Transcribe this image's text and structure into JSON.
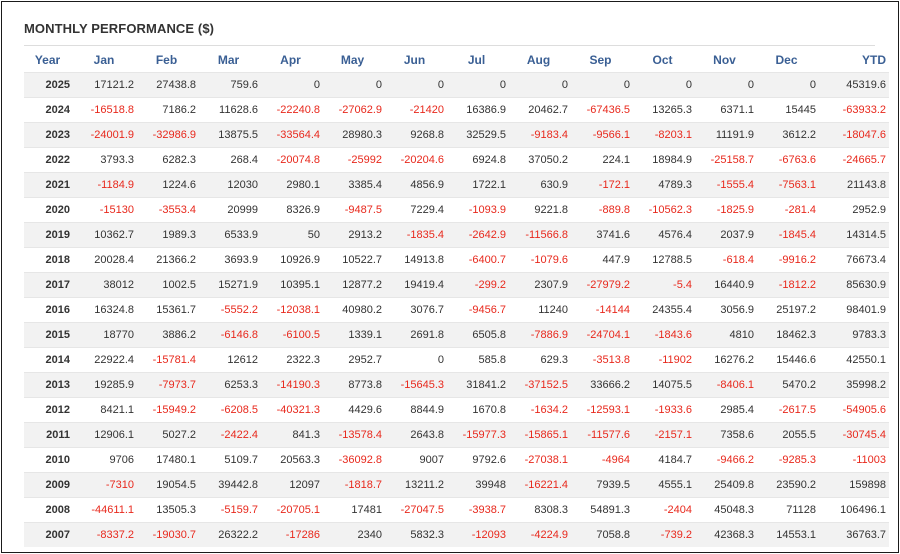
{
  "title": "MONTHLY PERFORMANCE ($)",
  "colors": {
    "header_text": "#3a5f94",
    "negative": "#e8281c",
    "row_stripe": "#f2f2f2"
  },
  "columns": [
    "Year",
    "Jan",
    "Feb",
    "Mar",
    "Apr",
    "May",
    "Jun",
    "Jul",
    "Aug",
    "Sep",
    "Oct",
    "Nov",
    "Dec",
    "YTD"
  ],
  "rows": [
    [
      "2025",
      "17121.2",
      "27438.8",
      "759.6",
      "0",
      "0",
      "0",
      "0",
      "0",
      "0",
      "0",
      "0",
      "0",
      "45319.6"
    ],
    [
      "2024",
      "-16518.8",
      "7186.2",
      "11628.6",
      "-22240.8",
      "-27062.9",
      "-21420",
      "16386.9",
      "20462.7",
      "-67436.5",
      "13265.3",
      "6371.1",
      "15445",
      "-63933.2"
    ],
    [
      "2023",
      "-24001.9",
      "-32986.9",
      "13875.5",
      "-33564.4",
      "28980.3",
      "9268.8",
      "32529.5",
      "-9183.4",
      "-9566.1",
      "-8203.1",
      "11191.9",
      "3612.2",
      "-18047.6"
    ],
    [
      "2022",
      "3793.3",
      "6282.3",
      "268.4",
      "-20074.8",
      "-25992",
      "-20204.6",
      "6924.8",
      "37050.2",
      "224.1",
      "18984.9",
      "-25158.7",
      "-6763.6",
      "-24665.7"
    ],
    [
      "2021",
      "-1184.9",
      "1224.6",
      "12030",
      "2980.1",
      "3385.4",
      "4856.9",
      "1722.1",
      "630.9",
      "-172.1",
      "4789.3",
      "-1555.4",
      "-7563.1",
      "21143.8"
    ],
    [
      "2020",
      "-15130",
      "-3553.4",
      "20999",
      "8326.9",
      "-9487.5",
      "7229.4",
      "-1093.9",
      "9221.8",
      "-889.8",
      "-10562.3",
      "-1825.9",
      "-281.4",
      "2952.9"
    ],
    [
      "2019",
      "10362.7",
      "1989.3",
      "6533.9",
      "50",
      "2913.2",
      "-1835.4",
      "-2642.9",
      "-11566.8",
      "3741.6",
      "4576.4",
      "2037.9",
      "-1845.4",
      "14314.5"
    ],
    [
      "2018",
      "20028.4",
      "21366.2",
      "3693.9",
      "10926.9",
      "10522.7",
      "14913.8",
      "-6400.7",
      "-1079.6",
      "447.9",
      "12788.5",
      "-618.4",
      "-9916.2",
      "76673.4"
    ],
    [
      "2017",
      "38012",
      "1002.5",
      "15271.9",
      "10395.1",
      "12877.2",
      "19419.4",
      "-299.2",
      "2307.9",
      "-27979.2",
      "-5.4",
      "16440.9",
      "-1812.2",
      "85630.9"
    ],
    [
      "2016",
      "16324.8",
      "15361.7",
      "-5552.2",
      "-12038.1",
      "40980.2",
      "3076.7",
      "-9456.7",
      "11240",
      "-14144",
      "24355.4",
      "3056.9",
      "25197.2",
      "98401.9"
    ],
    [
      "2015",
      "18770",
      "3886.2",
      "-6146.8",
      "-6100.5",
      "1339.1",
      "2691.8",
      "6505.8",
      "-7886.9",
      "-24704.1",
      "-1843.6",
      "4810",
      "18462.3",
      "9783.3"
    ],
    [
      "2014",
      "22922.4",
      "-15781.4",
      "12612",
      "2322.3",
      "2952.7",
      "0",
      "585.8",
      "629.3",
      "-3513.8",
      "-11902",
      "16276.2",
      "15446.6",
      "42550.1"
    ],
    [
      "2013",
      "19285.9",
      "-7973.7",
      "6253.3",
      "-14190.3",
      "8773.8",
      "-15645.3",
      "31841.2",
      "-37152.5",
      "33666.2",
      "14075.5",
      "-8406.1",
      "5470.2",
      "35998.2"
    ],
    [
      "2012",
      "8421.1",
      "-15949.2",
      "-6208.5",
      "-40321.3",
      "4429.6",
      "8844.9",
      "1670.8",
      "-1634.2",
      "-12593.1",
      "-1933.6",
      "2985.4",
      "-2617.5",
      "-54905.6"
    ],
    [
      "2011",
      "12906.1",
      "5027.2",
      "-2422.4",
      "841.3",
      "-13578.4",
      "2643.8",
      "-15977.3",
      "-15865.1",
      "-11577.6",
      "-2157.1",
      "7358.6",
      "2055.5",
      "-30745.4"
    ],
    [
      "2010",
      "9706",
      "17480.1",
      "5109.7",
      "20563.3",
      "-36092.8",
      "9007",
      "9792.6",
      "-27038.1",
      "-4964",
      "4184.7",
      "-9466.2",
      "-9285.3",
      "-11003"
    ],
    [
      "2009",
      "-7310",
      "19054.5",
      "39442.8",
      "12097",
      "-1818.7",
      "13211.2",
      "39948",
      "-16221.4",
      "7939.5",
      "4555.1",
      "25409.8",
      "23590.2",
      "159898"
    ],
    [
      "2008",
      "-44611.1",
      "13505.3",
      "-5159.7",
      "-20705.1",
      "17481",
      "-27047.5",
      "-3938.7",
      "8308.3",
      "54891.3",
      "-2404",
      "45048.3",
      "71128",
      "106496.1"
    ],
    [
      "2007",
      "-8337.2",
      "-19030.7",
      "26322.2",
      "-17286",
      "2340",
      "5832.3",
      "-12093",
      "-4224.9",
      "7058.8",
      "-739.2",
      "42368.3",
      "14553.1",
      "36763.7"
    ]
  ]
}
